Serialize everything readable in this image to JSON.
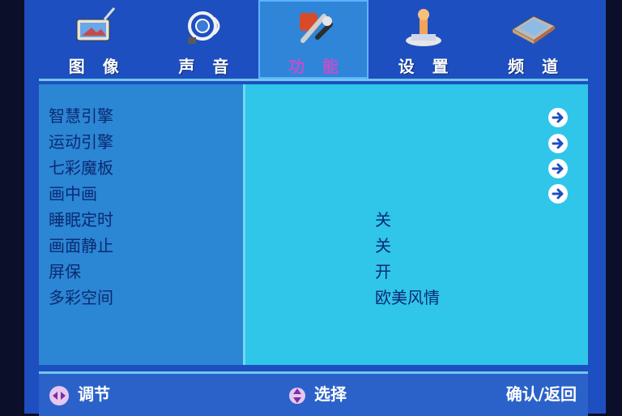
{
  "tabs": [
    {
      "label": "图像",
      "icon": "picture-icon",
      "active": false
    },
    {
      "label": "声音",
      "icon": "sound-icon",
      "active": false
    },
    {
      "label": "功能",
      "icon": "tools-icon",
      "active": true
    },
    {
      "label": "设置",
      "icon": "settings-icon",
      "active": false
    },
    {
      "label": "频道",
      "icon": "channel-icon",
      "active": false
    }
  ],
  "menu": {
    "items": [
      {
        "label": "智慧引擎",
        "value": "",
        "submenu": true
      },
      {
        "label": "运动引擎",
        "value": "",
        "submenu": true
      },
      {
        "label": "七彩魔板",
        "value": "",
        "submenu": true
      },
      {
        "label": "画中画",
        "value": "",
        "submenu": true
      },
      {
        "label": "睡眠定时",
        "value": "关",
        "submenu": false
      },
      {
        "label": "画面静止",
        "value": "关",
        "submenu": false
      },
      {
        "label": "屏保",
        "value": "开",
        "submenu": false
      },
      {
        "label": "多彩空间",
        "value": "欧美风情",
        "submenu": false
      }
    ]
  },
  "footer": {
    "adjust_label": "调节",
    "select_label": "选择",
    "confirm_label": "确认/返回"
  },
  "colors": {
    "frame": "#1e4fc0",
    "left_panel": "#2b86d4",
    "right_panel": "#2fc6ea",
    "text": "#0b2a72",
    "active_tab_label": "#c04fd0"
  }
}
